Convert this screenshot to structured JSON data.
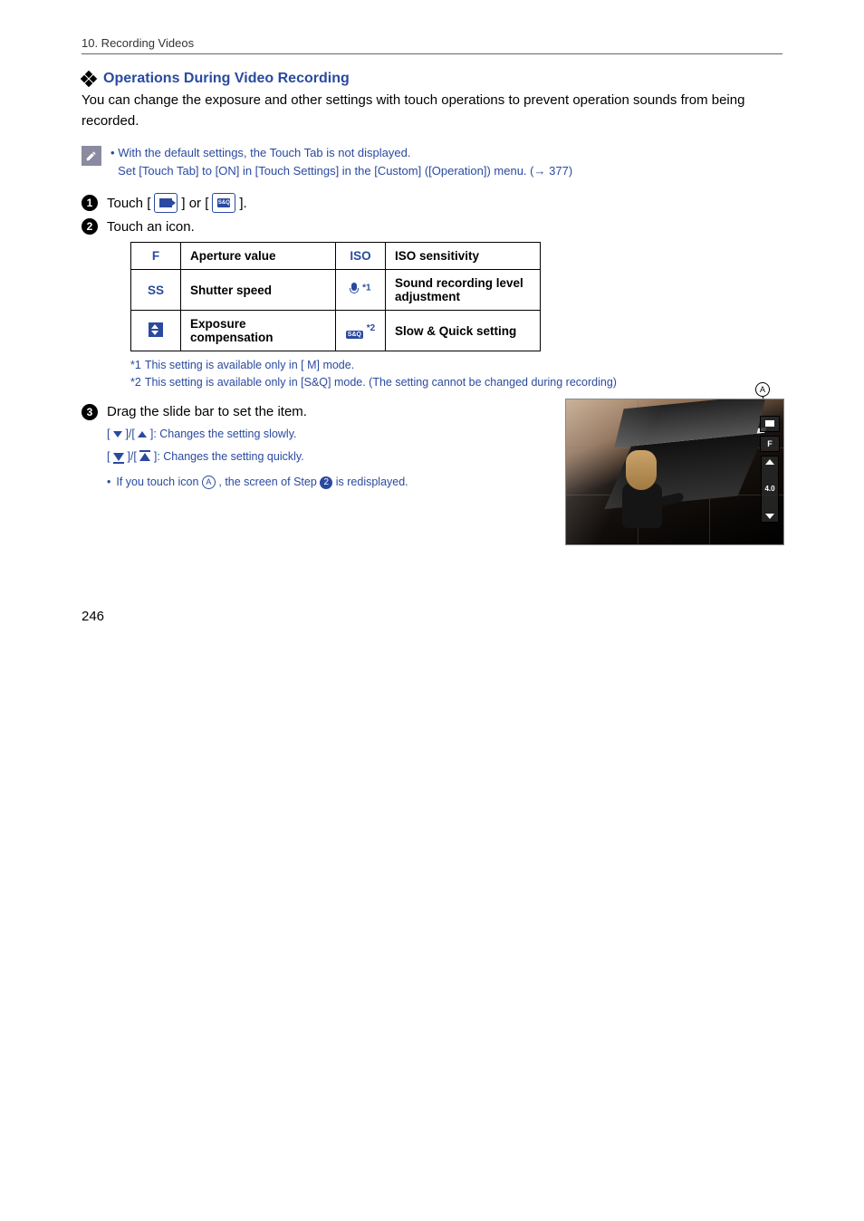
{
  "header": "10. Recording Videos",
  "section_title": "Operations During Video Recording",
  "intro": "You can change the exposure and other settings with touch operations to prevent operation sounds from being recorded.",
  "note": {
    "bullet": "•",
    "line1": "With the default settings, the Touch Tab is not displayed.",
    "line2_a": "Set [Touch Tab] to [ON] in [Touch Settings] in the [Custom] ([Operation]) menu. (",
    "line2_arrow": "→",
    "line2_link": "377",
    "line2_b": ")"
  },
  "steps": {
    "s1_a": "Touch [",
    "s1_b": "] or [",
    "s1_c": "].",
    "s2": "Touch an icon.",
    "s3": "Drag the slide bar to set the item."
  },
  "table": {
    "r1c1": "F",
    "r1c2": "Aperture value",
    "r1c3": "ISO",
    "r1c4": "ISO sensitivity",
    "r2c1": "SS",
    "r2c2": "Shutter speed",
    "r2c3_sup": "*1",
    "r2c4": "Sound recording level adjustment",
    "r3c2": "Exposure compensation",
    "r3c3_sup": "*2",
    "r3c3_chip": "S&Q",
    "r3c4": "Slow & Quick setting"
  },
  "footnotes": {
    "f1_k": "*1",
    "f1_v": "This setting is available only in [  M] mode.",
    "f2_k": "*2",
    "f2_v": "This setting is available only in [S&Q] mode. (The setting cannot be changed during recording)"
  },
  "sub": {
    "slow_a": "[",
    "slow_b": "]/[",
    "slow_c": "]:  Changes the setting slowly.",
    "quick_a": "[",
    "quick_b": "]/[",
    "quick_c": "]:  Changes the setting quickly.",
    "touch_a": "If you touch icon ",
    "touch_b": ", the screen of Step ",
    "touch_c": " is redisplayed."
  },
  "marker_a": "A",
  "slider_label": "F",
  "slider_val": "4.0",
  "inline_step": "2",
  "page_number": "246"
}
